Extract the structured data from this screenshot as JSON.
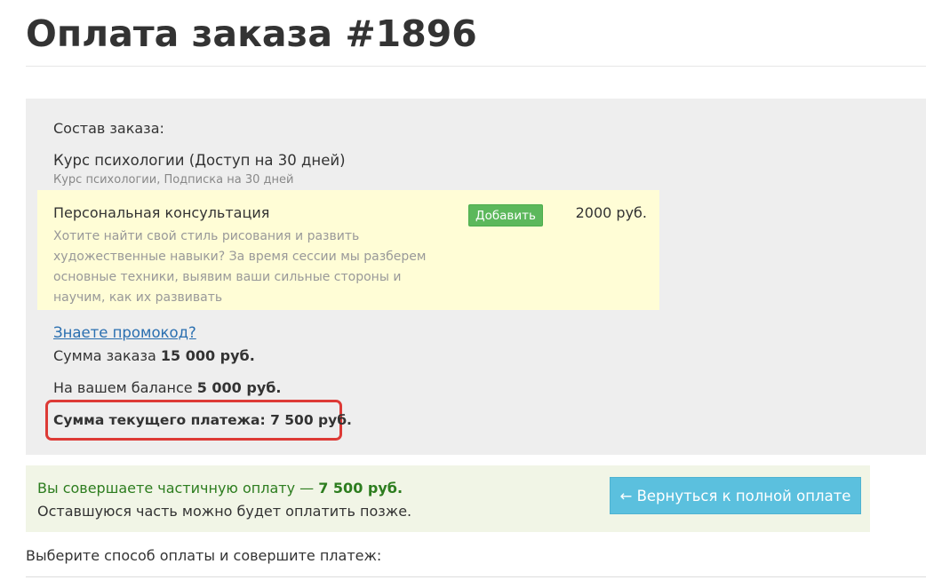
{
  "page": {
    "title": "Оплата заказа #1896"
  },
  "order": {
    "section_label": "Состав заказа:",
    "product": {
      "name": "Курс психологии (Доступ на 30 дней)",
      "subtitle": "Курс психологии, Подписка на 30 дней"
    },
    "upsell": {
      "title": "Персональная консультация",
      "description": "Хотите найти свой стиль рисования и развить художественные навыки? За время сессии мы разберем основные техники, выявим ваши сильные стороны и научим, как их развивать",
      "add_label": "Добавить",
      "price": "2000 руб."
    },
    "promo_link": "Знаете промокод?",
    "sum_label": "Сумма заказа",
    "sum_value": "15 000 руб.",
    "balance_label": "На вашем балансе",
    "balance_value": "5 000 руб.",
    "current_payment": "Сумма текущего платежа: 7 500 руб."
  },
  "partial": {
    "line1_text": "Вы совершаете частичную оплату —",
    "line1_amount": "7 500 руб.",
    "line2": "Оставшуюся часть можно будет оплатить позже.",
    "back_button": "← Вернуться к полной оплате"
  },
  "payment": {
    "instruction": "Выберите способ оплаты и совершите платеж:"
  },
  "colors": {
    "add_button": "#5cb85c",
    "back_button": "#5bc0de",
    "highlight_border": "#dd3a36",
    "partial_text": "#2d7d1f",
    "link": "#2a6fb0"
  }
}
